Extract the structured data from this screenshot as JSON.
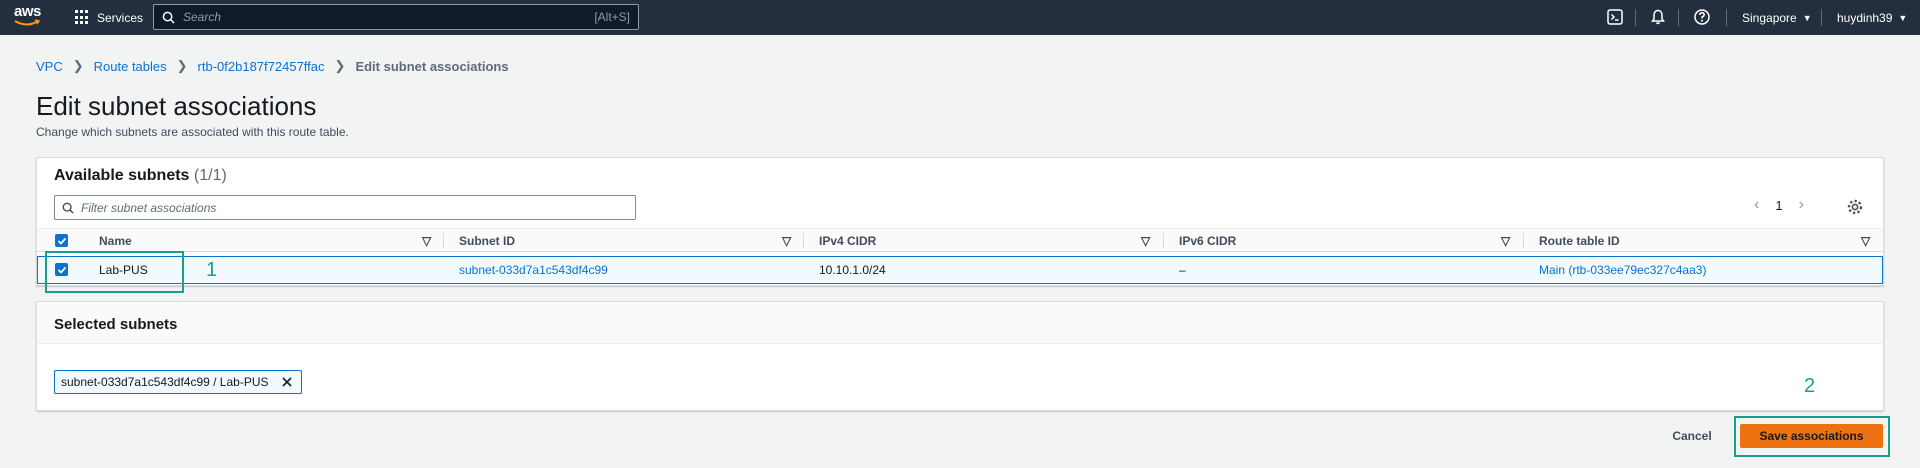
{
  "nav": {
    "logo_text": "aws",
    "services_label": "Services",
    "search_placeholder": "Search",
    "search_shortcut": "[Alt+S]",
    "region": "Singapore",
    "user": "huydinh39"
  },
  "breadcrumb": {
    "items": [
      "VPC",
      "Route tables",
      "rtb-0f2b187f72457ffac"
    ],
    "current": "Edit subnet associations"
  },
  "page": {
    "title": "Edit subnet associations",
    "description": "Change which subnets are associated with this route table."
  },
  "available": {
    "title": "Available subnets",
    "count": "(1/1)",
    "filter_placeholder": "Filter subnet associations",
    "page_number": "1",
    "columns": [
      "Name",
      "Subnet ID",
      "IPv4 CIDR",
      "IPv6 CIDR",
      "Route table ID"
    ],
    "rows": [
      {
        "name": "Lab-PUS",
        "subnet_id": "subnet-033d7a1c543df4c99",
        "ipv4": "10.10.1.0/24",
        "ipv6": "–",
        "route_table": "Main (rtb-033ee79ec327c4aa3)"
      }
    ]
  },
  "selected": {
    "title": "Selected subnets",
    "token": "subnet-033d7a1c543df4c99 / Lab-PUS"
  },
  "actions": {
    "cancel": "Cancel",
    "save": "Save associations"
  },
  "annotations": {
    "one": "1",
    "two": "2"
  },
  "colors": {
    "nav_bg": "#232f3e",
    "link": "#0972d3",
    "primary_button": "#ec7211",
    "annotation": "#1aa088"
  }
}
